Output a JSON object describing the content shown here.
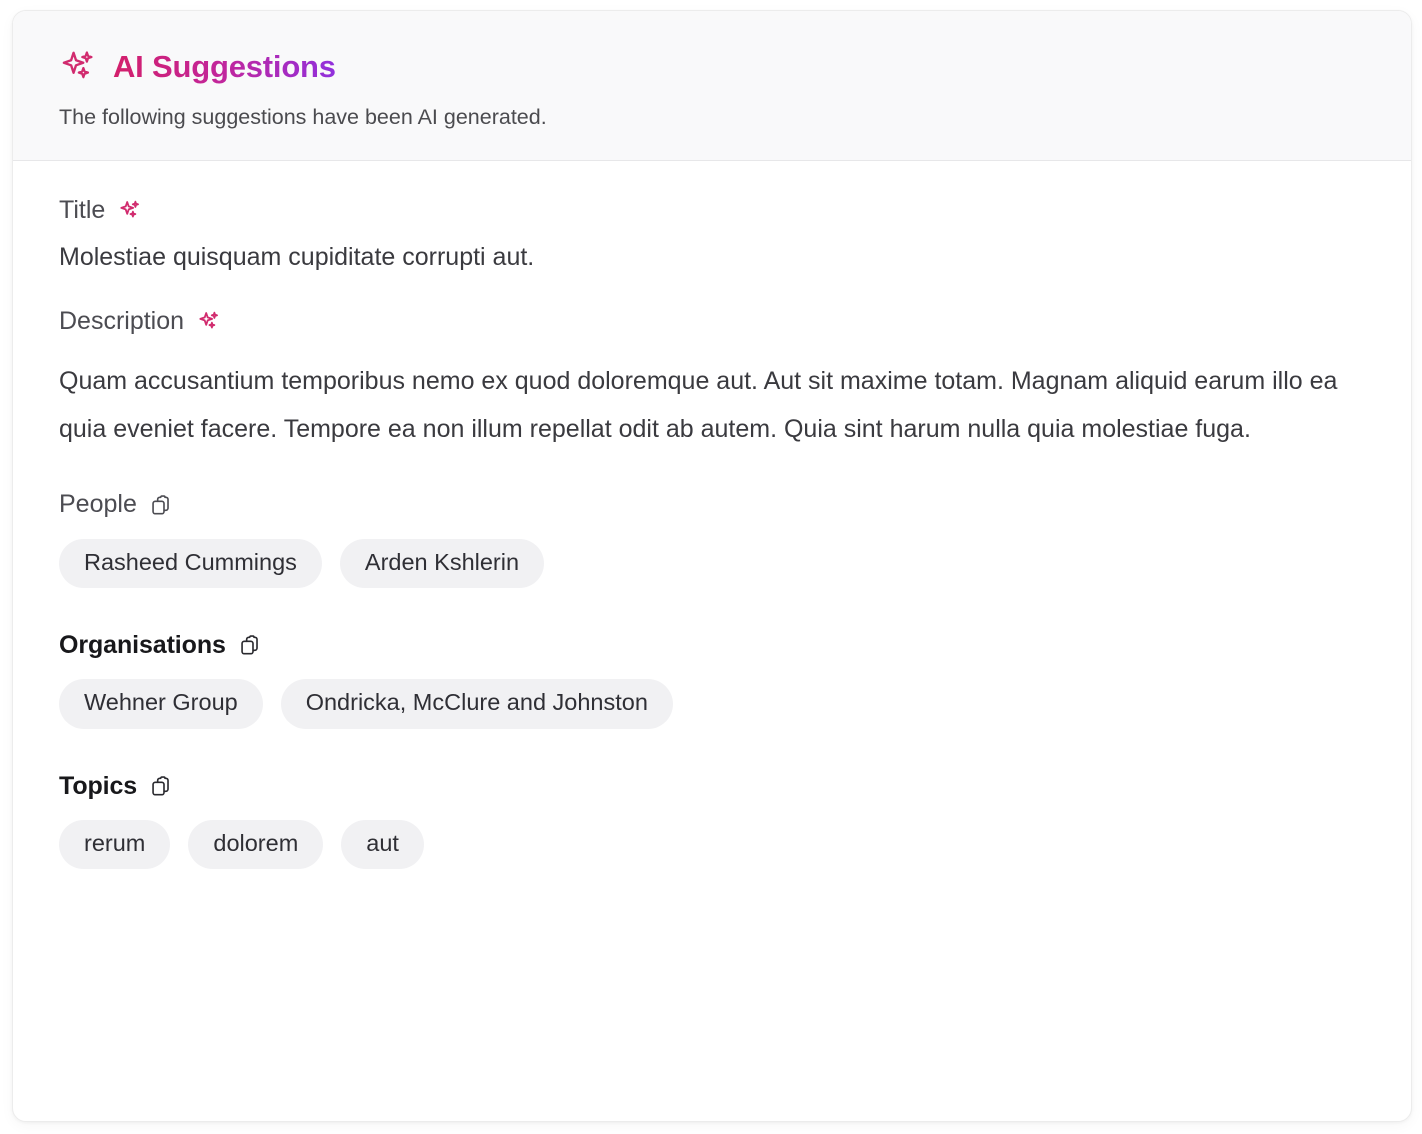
{
  "header": {
    "icon": "sparkles-icon",
    "title": "AI Suggestions",
    "subtitle": "The following suggestions have been AI generated.",
    "gradient_from": "#d31f6a",
    "gradient_to": "#9130dd",
    "background": "#f9f9fa"
  },
  "fields": {
    "title": {
      "label": "Title",
      "icon": "sparkles-icon",
      "value": "Molestiae quisquam cupiditate corrupti aut."
    },
    "description": {
      "label": "Description",
      "icon": "sparkles-icon",
      "value": "Quam accusantium temporibus nemo ex quod doloremque aut. Aut sit maxime totam. Magnam aliquid earum illo ea quia eveniet facere. Tempore ea non illum repellat odit ab autem. Quia sint harum nulla quia molestiae fuga."
    },
    "people": {
      "label": "People",
      "icon": "copy-icon",
      "tags": [
        "Rasheed Cummings",
        "Arden Kshlerin"
      ]
    },
    "organisations": {
      "label": "Organisations",
      "icon": "copy-icon",
      "tags": [
        "Wehner Group",
        "Ondricka, McClure and Johnston"
      ]
    },
    "topics": {
      "label": "Topics",
      "icon": "copy-icon",
      "tags": [
        "rerum",
        "dolorem",
        "aut"
      ]
    }
  },
  "colors": {
    "tag_background": "#f1f1f3",
    "tag_text": "#2f2f35",
    "sparkle_pink": "#d12b6e",
    "card_background": "#ffffff",
    "divider": "#e7e7e9"
  }
}
